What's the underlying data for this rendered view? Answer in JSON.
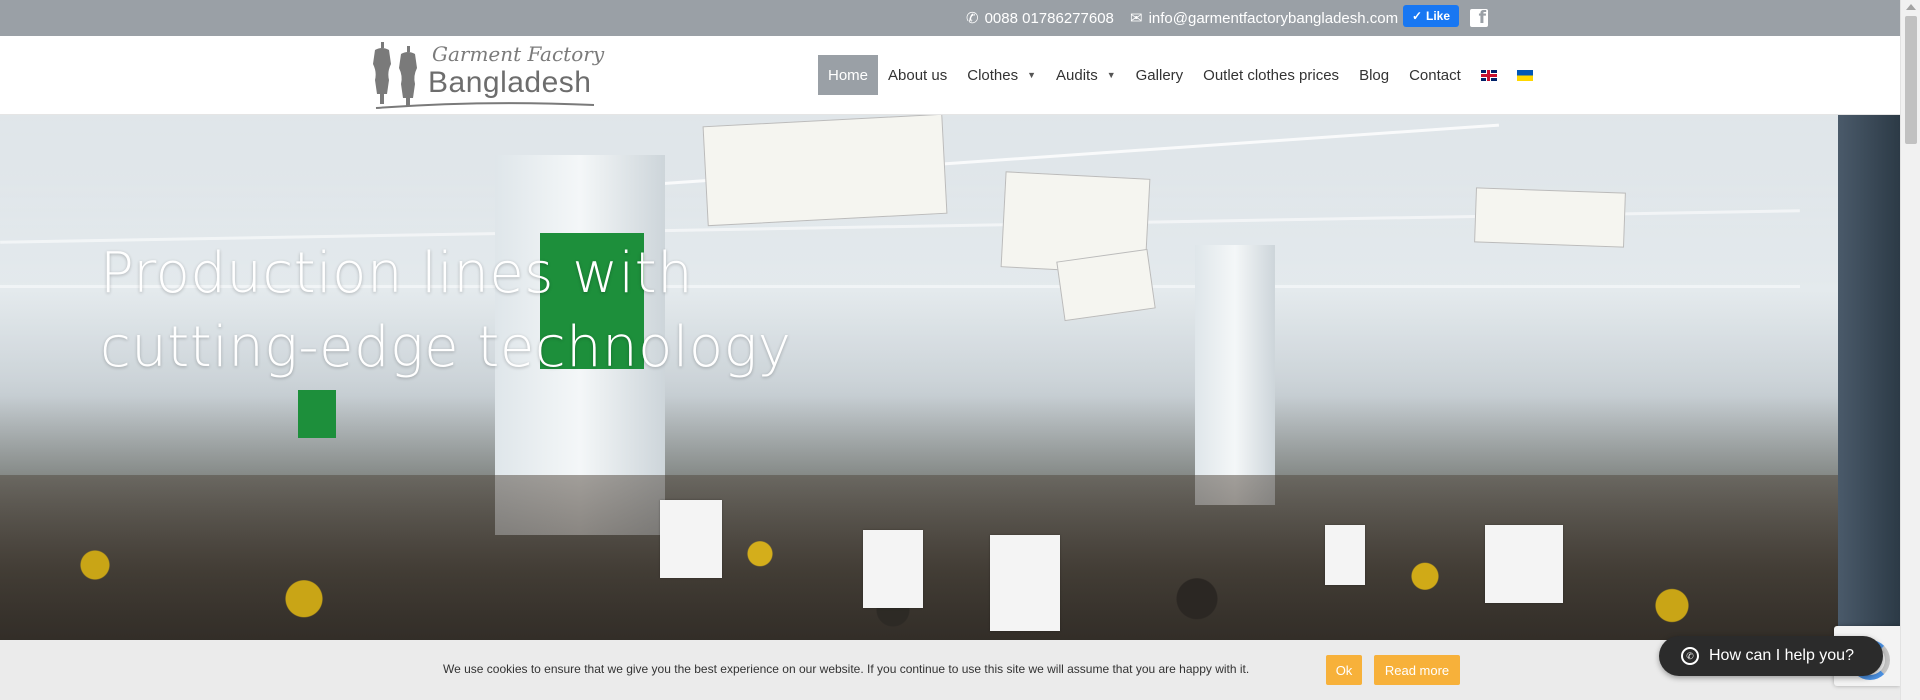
{
  "topbar": {
    "phone": "0088 01786277608",
    "email": "info@garmentfactorybangladesh.com",
    "fb_like_label": "Like",
    "phone_icon": "phone-icon",
    "email_icon": "envelope-icon",
    "social_icon": "facebook-icon"
  },
  "logo": {
    "script_text": "Garment Factory",
    "main_text": "Bangladesh"
  },
  "nav": {
    "items": [
      {
        "label": "Home",
        "active": true
      },
      {
        "label": "About us"
      },
      {
        "label": "Clothes",
        "dropdown": true
      },
      {
        "label": "Audits",
        "dropdown": true
      },
      {
        "label": "Gallery"
      },
      {
        "label": "Outlet clothes prices"
      },
      {
        "label": "Blog"
      },
      {
        "label": "Contact"
      }
    ],
    "languages": [
      "english-flag-icon",
      "ukrainian-flag-icon"
    ]
  },
  "hero": {
    "title_line1": "Production lines with",
    "title_line2": "cutting-edge technology"
  },
  "cookie": {
    "message": "We use cookies to ensure that we give you the best experience on our website. If you continue to use this site we will assume that you are happy with it.",
    "ok_label": "Ok",
    "read_more_label": "Read more"
  },
  "chat": {
    "label": "How can I help you?"
  },
  "colors": {
    "accent": "#9aa0a6",
    "cookie_button": "#f7b13a",
    "chat_bg": "#2b2b2b"
  }
}
